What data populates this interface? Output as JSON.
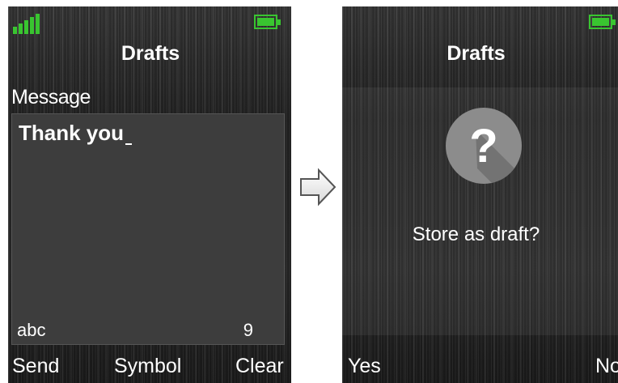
{
  "left_screen": {
    "status": {
      "signal_icon": "signal-strength-icon",
      "battery_icon": "battery-icon"
    },
    "title": "Drafts",
    "message_label": "Message",
    "message_text": "Thank you",
    "input_mode": "abc",
    "char_count": "9",
    "softkeys": {
      "left": "Send",
      "center": "Symbol",
      "right": "Clear"
    }
  },
  "transition_arrow": "right-arrow-icon",
  "right_screen": {
    "status": {
      "battery_icon": "battery-icon"
    },
    "title": "Drafts",
    "dialog": {
      "icon": "question-mark-icon",
      "text": "Store as draft?"
    },
    "softkeys": {
      "left": "Yes",
      "right": "No"
    }
  },
  "colors": {
    "status_green": "#39c530",
    "text": "#ffffff",
    "editor_bg": "#3d3d3d",
    "icon_circle": "#8c8c8c"
  }
}
